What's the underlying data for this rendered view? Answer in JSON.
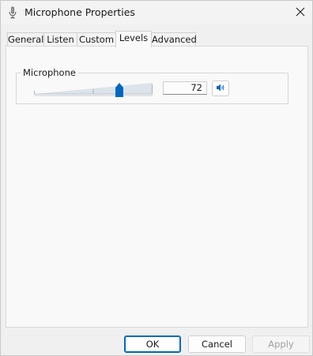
{
  "window": {
    "title": "Microphone Properties",
    "icon": "microphone-icon",
    "close_icon": "close-icon"
  },
  "tabs": [
    {
      "label": "General",
      "active": false
    },
    {
      "label": "Listen",
      "active": false
    },
    {
      "label": "Custom",
      "active": false
    },
    {
      "label": "Levels",
      "active": true
    },
    {
      "label": "Advanced",
      "active": false
    }
  ],
  "levels": {
    "group_label": "Microphone",
    "level_value": "72",
    "level_fraction": 0.72,
    "mute_icon": "speaker-icon"
  },
  "buttons": {
    "ok": "OK",
    "cancel": "Cancel",
    "apply": "Apply"
  },
  "colors": {
    "accent": "#0067c0"
  }
}
